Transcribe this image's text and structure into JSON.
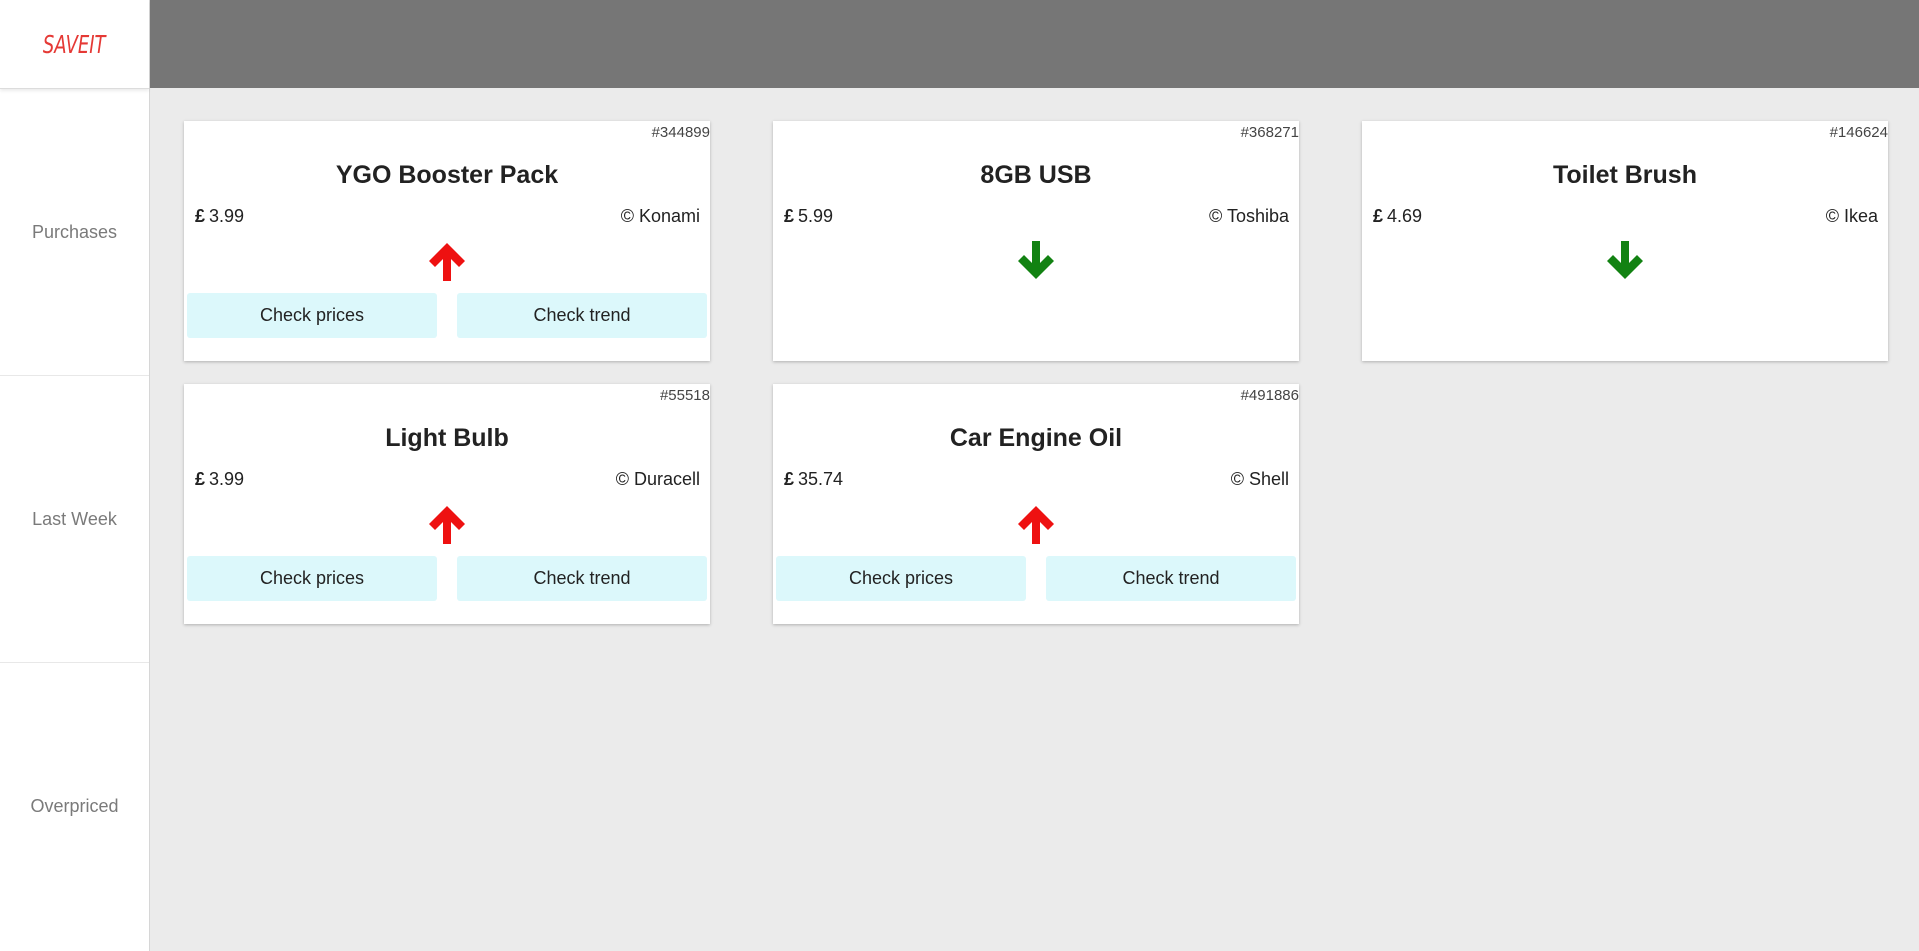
{
  "app": {
    "logo": "SAVEIT"
  },
  "sidebar": {
    "items": [
      {
        "label": "Purchases"
      },
      {
        "label": "Last Week"
      },
      {
        "label": "Overpriced"
      }
    ]
  },
  "colors": {
    "up": "#ee1111",
    "down": "#128212",
    "button_bg": "#dcf8fb",
    "topbar": "#767676"
  },
  "currency_symbol": "£",
  "cards": [
    {
      "code": "#344899",
      "title": "YGO Booster Pack",
      "price": "3.99",
      "brand": "© Konami",
      "trend": "up",
      "check_prices": "Check prices",
      "check_trend": "Check trend"
    },
    {
      "code": "#368271",
      "title": "8GB USB",
      "price": "5.99",
      "brand": "© Toshiba",
      "trend": "down"
    },
    {
      "code": "#146624",
      "title": "Toilet Brush",
      "price": "4.69",
      "brand": "© Ikea",
      "trend": "down"
    },
    {
      "code": "#55518",
      "title": "Light Bulb",
      "price": "3.99",
      "brand": "© Duracell",
      "trend": "up",
      "check_prices": "Check prices",
      "check_trend": "Check trend"
    },
    {
      "code": "#491886",
      "title": "Car Engine Oil",
      "price": "35.74",
      "brand": "© Shell",
      "trend": "up",
      "check_prices": "Check prices",
      "check_trend": "Check trend"
    }
  ]
}
